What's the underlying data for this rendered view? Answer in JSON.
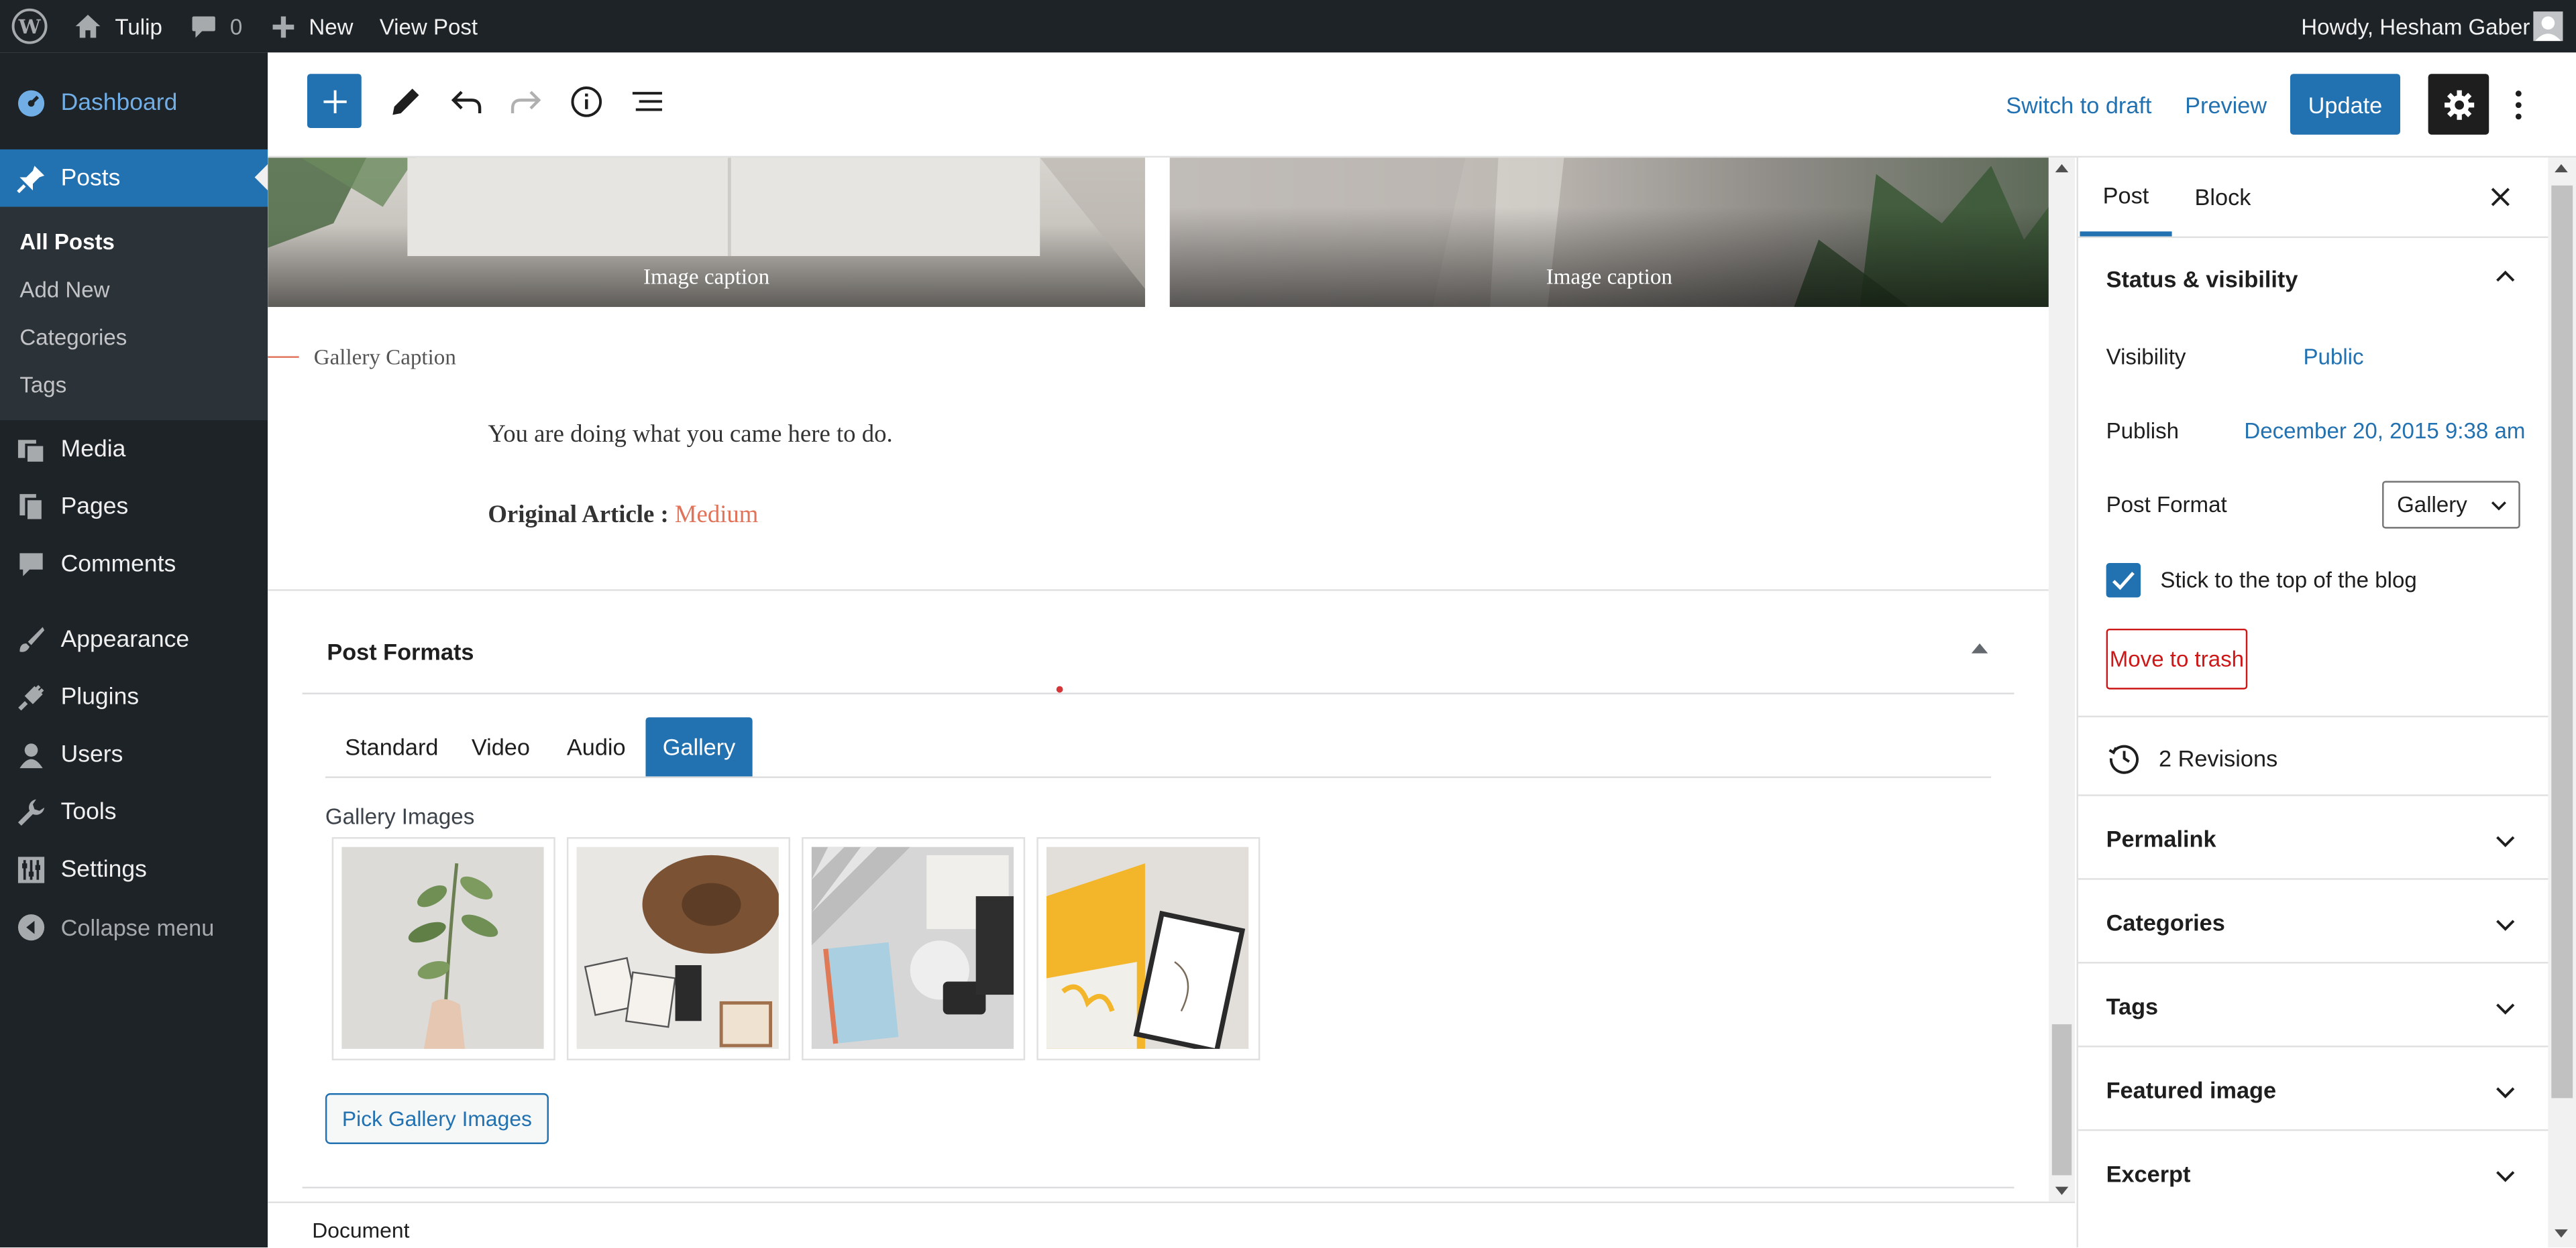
{
  "adminbar": {
    "site_name": "Tulip",
    "comments_count": "0",
    "new_label": "New",
    "view_post_label": "View Post",
    "howdy": "Howdy, Hesham Gaber"
  },
  "sidebar": {
    "dashboard": "Dashboard",
    "posts": "Posts",
    "sub": [
      "All Posts",
      "Add New",
      "Categories",
      "Tags"
    ],
    "media": "Media",
    "pages": "Pages",
    "comments": "Comments",
    "appearance": "Appearance",
    "plugins": "Plugins",
    "users": "Users",
    "tools": "Tools",
    "settings": "Settings",
    "collapse": "Collapse menu"
  },
  "toolbar": {
    "switch_to_draft": "Switch to draft",
    "preview": "Preview",
    "update": "Update"
  },
  "content": {
    "image_caption_1": "Image caption",
    "image_caption_2": "Image caption",
    "gallery_caption": "Gallery Caption",
    "paragraph": "You are doing what you came here to do.",
    "original_label": "Original Article :",
    "original_link": "Medium"
  },
  "post_formats": {
    "title": "Post Formats",
    "tabs": [
      "Standard",
      "Video",
      "Audio",
      "Gallery"
    ],
    "active_tab": "Gallery",
    "gallery_images_label": "Gallery Images",
    "images": [
      "plant-branch-photo",
      "hat-and-photos-photo",
      "notebook-and-camera-photo",
      "yellow-chair-and-frame-photo"
    ],
    "pick_button": "Pick Gallery Images"
  },
  "status_bar": {
    "breadcrumb": "Document"
  },
  "panel": {
    "tabs": [
      "Post",
      "Block"
    ],
    "active_tab": "Post",
    "status_visibility": "Status & visibility",
    "visibility_label": "Visibility",
    "visibility_value": "Public",
    "publish_label": "Publish",
    "publish_value": "December 20, 2015 9:38 am",
    "post_format_label": "Post Format",
    "post_format_value": "Gallery",
    "sticky_label": "Stick to the top of the blog",
    "sticky_checked": true,
    "move_to_trash": "Move to trash",
    "revisions": "2 Revisions",
    "permalink": "Permalink",
    "categories": "Categories",
    "tags": "Tags",
    "featured_image": "Featured image",
    "excerpt": "Excerpt"
  },
  "colors": {
    "wp_blue": "#2271b1",
    "admin_dark": "#1d2327",
    "link_orange": "#e0735a",
    "trash_red": "#cc1818"
  }
}
